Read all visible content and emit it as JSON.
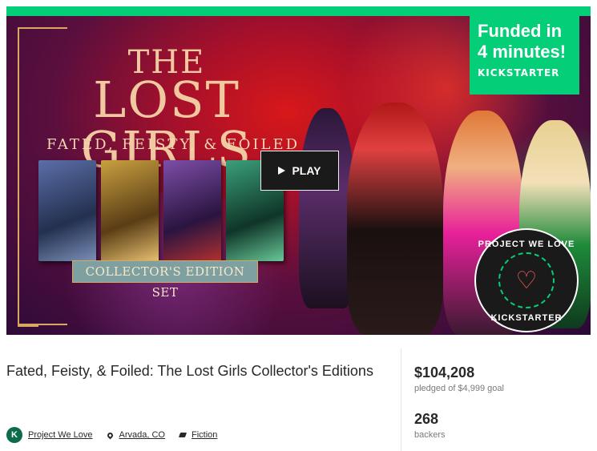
{
  "hero": {
    "title_top": "THE",
    "title_main": "LOST GIRLS",
    "tagline": "FATED, FEISTY, & FOILED",
    "banner": "COLLECTOR'S EDITION SET",
    "play_label": "PLAY",
    "funded_line1": "Funded in",
    "funded_line2": "4 minutes!",
    "funded_brand": "KICKSTARTER",
    "pwl_top": "PROJECT WE LOVE",
    "pwl_bottom": "KICKSTARTER",
    "accent_color": "#05ce78"
  },
  "project": {
    "title": "Fated, Feisty, & Foiled: The Lost Girls Collector's Editions",
    "badge_letter": "K",
    "project_we_love": "Project We Love",
    "location": "Arvada, CO",
    "category": "Fiction"
  },
  "stats": {
    "pledged": "$104,208",
    "pledged_label": "pledged of $4,999 goal",
    "backers": "268",
    "backers_label": "backers"
  }
}
